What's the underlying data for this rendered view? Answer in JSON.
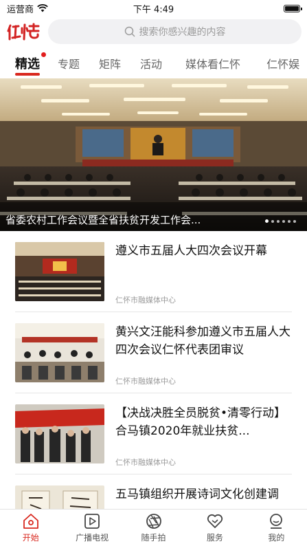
{
  "status_bar": {
    "carrier": "运营商",
    "time": "下午 4:49",
    "battery_level": 1.0
  },
  "header": {
    "logo_text": "仁怀",
    "search_placeholder": "搜索你感兴趣的内容"
  },
  "tabs": [
    {
      "label": "精选",
      "active": true,
      "has_dot": true
    },
    {
      "label": "专题",
      "active": false
    },
    {
      "label": "矩阵",
      "active": false
    },
    {
      "label": "活动",
      "active": false
    },
    {
      "label": "媒体看仁怀",
      "active": false
    },
    {
      "label": "仁怀娱",
      "active": false
    }
  ],
  "hero": {
    "caption": "省委农村工作会议暨全省扶贫开发工作会...",
    "slide_count": 6,
    "active_slide": 1
  },
  "news": [
    {
      "title": "遵义市五届人大四次会议开幕",
      "source": "仁怀市融媒体中心"
    },
    {
      "title": "黄兴文汪能科参加遵义市五届人大四次会议仁怀代表团审议",
      "source": "仁怀市融媒体中心"
    },
    {
      "title": "【决战决胜全员脱贫•清零行动】 合马镇2020年就业扶贫...",
      "source": "仁怀市融媒体中心"
    },
    {
      "title": "五马镇组织开展诗词文化创建调",
      "source": ""
    }
  ],
  "bottom_nav": [
    {
      "label": "开始",
      "icon": "home-icon",
      "active": true
    },
    {
      "label": "广播电视",
      "icon": "play-icon",
      "active": false
    },
    {
      "label": "随手拍",
      "icon": "aperture-icon",
      "active": false
    },
    {
      "label": "服务",
      "icon": "heart-icon",
      "active": false
    },
    {
      "label": "我的",
      "icon": "profile-icon",
      "active": false
    }
  ],
  "colors": {
    "accent": "#d9281f",
    "search_bg": "#f1f1f3"
  }
}
